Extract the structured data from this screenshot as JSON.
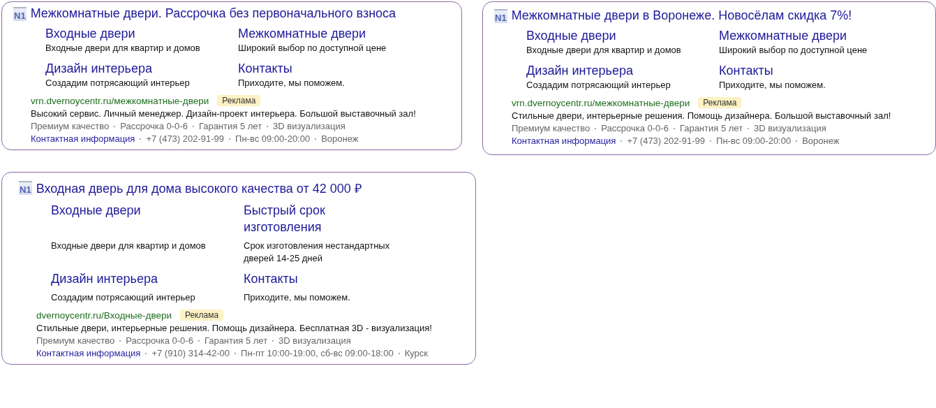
{
  "ads": [
    {
      "logo": "N1",
      "title": "Межкомнатные двери. Рассрочка без первоначального взноса",
      "sitelinks": [
        {
          "title": "Входные двери",
          "text": "Входные двери для квартир и домов"
        },
        {
          "title": "Межкомнатные двери",
          "text": "Широкий выбор по доступной цене"
        },
        {
          "title": "Дизайн интерьера",
          "text": "Создадим потрясающий интерьер"
        },
        {
          "title": "Контакты",
          "text": "Приходите, мы поможем."
        }
      ],
      "url": "vrn.dvernoycentr.ru/межкомнатные-двери",
      "badge": "Реклама",
      "description": "Высокий сервис. Личный менеджер. Дизайн-проект интерьера. Большой выставочный зал!",
      "features": [
        "Премиум качество",
        "Рассрочка 0-0-6",
        "Гарантия 5 лет",
        "3D визуализация"
      ],
      "contact_link": "Контактная информация",
      "contacts": [
        "+7 (473) 202-91-99",
        "Пн-вс 09:00-20:00",
        "Воронеж"
      ]
    },
    {
      "logo": "N1",
      "title": "Межкомнатные двери в Воронеже. Новосёлам скидка 7%!",
      "sitelinks": [
        {
          "title": "Входные двери",
          "text": "Входные двери для квартир и домов"
        },
        {
          "title": "Межкомнатные двери",
          "text": "Широкий выбор по доступной цене"
        },
        {
          "title": "Дизайн интерьера",
          "text": "Создадим потрясающий интерьер"
        },
        {
          "title": "Контакты",
          "text": "Приходите, мы поможем."
        }
      ],
      "url": "vrn.dvernoycentr.ru/межкомнатные-двери",
      "badge": "Реклама",
      "description": "Стильные двери, интерьерные решения. Помощь дизайнера. Большой выставочный зал!",
      "features": [
        "Премиум качество",
        "Рассрочка 0-0-6",
        "Гарантия 5 лет",
        "3D визуализация"
      ],
      "contact_link": "Контактная информация",
      "contacts": [
        "+7 (473) 202-91-99",
        "Пн-вс 09:00-20:00",
        "Воронеж"
      ]
    },
    {
      "logo": "N1",
      "title": "Входная дверь для дома высокого качества от 42 000 ₽",
      "sitelinks": [
        {
          "title": "Входные двери",
          "text": "Входные двери для квартир и домов"
        },
        {
          "title": "Быстрый срок изготовления",
          "text": "Срок изготовления нестандартных дверей 14-25 дней"
        },
        {
          "title": "Дизайн интерьера",
          "text": "Создадим потрясающий интерьер"
        },
        {
          "title": "Контакты",
          "text": "Приходите, мы поможем."
        }
      ],
      "url": "dvernoycentr.ru/Входные-двери",
      "badge": "Реклама",
      "description": "Стильные двери, интерьерные решения. Помощь дизайнера. Бесплатная 3D - визуализация!",
      "features": [
        "Премиум качество",
        "Рассрочка 0-0-6",
        "Гарантия 5 лет",
        "3D визуализация"
      ],
      "contact_link": "Контактная информация",
      "contacts": [
        "+7 (910) 314-42-00",
        "Пн-пт 10:00-19:00, сб-вс 09:00-18:00",
        "Курск"
      ]
    }
  ]
}
